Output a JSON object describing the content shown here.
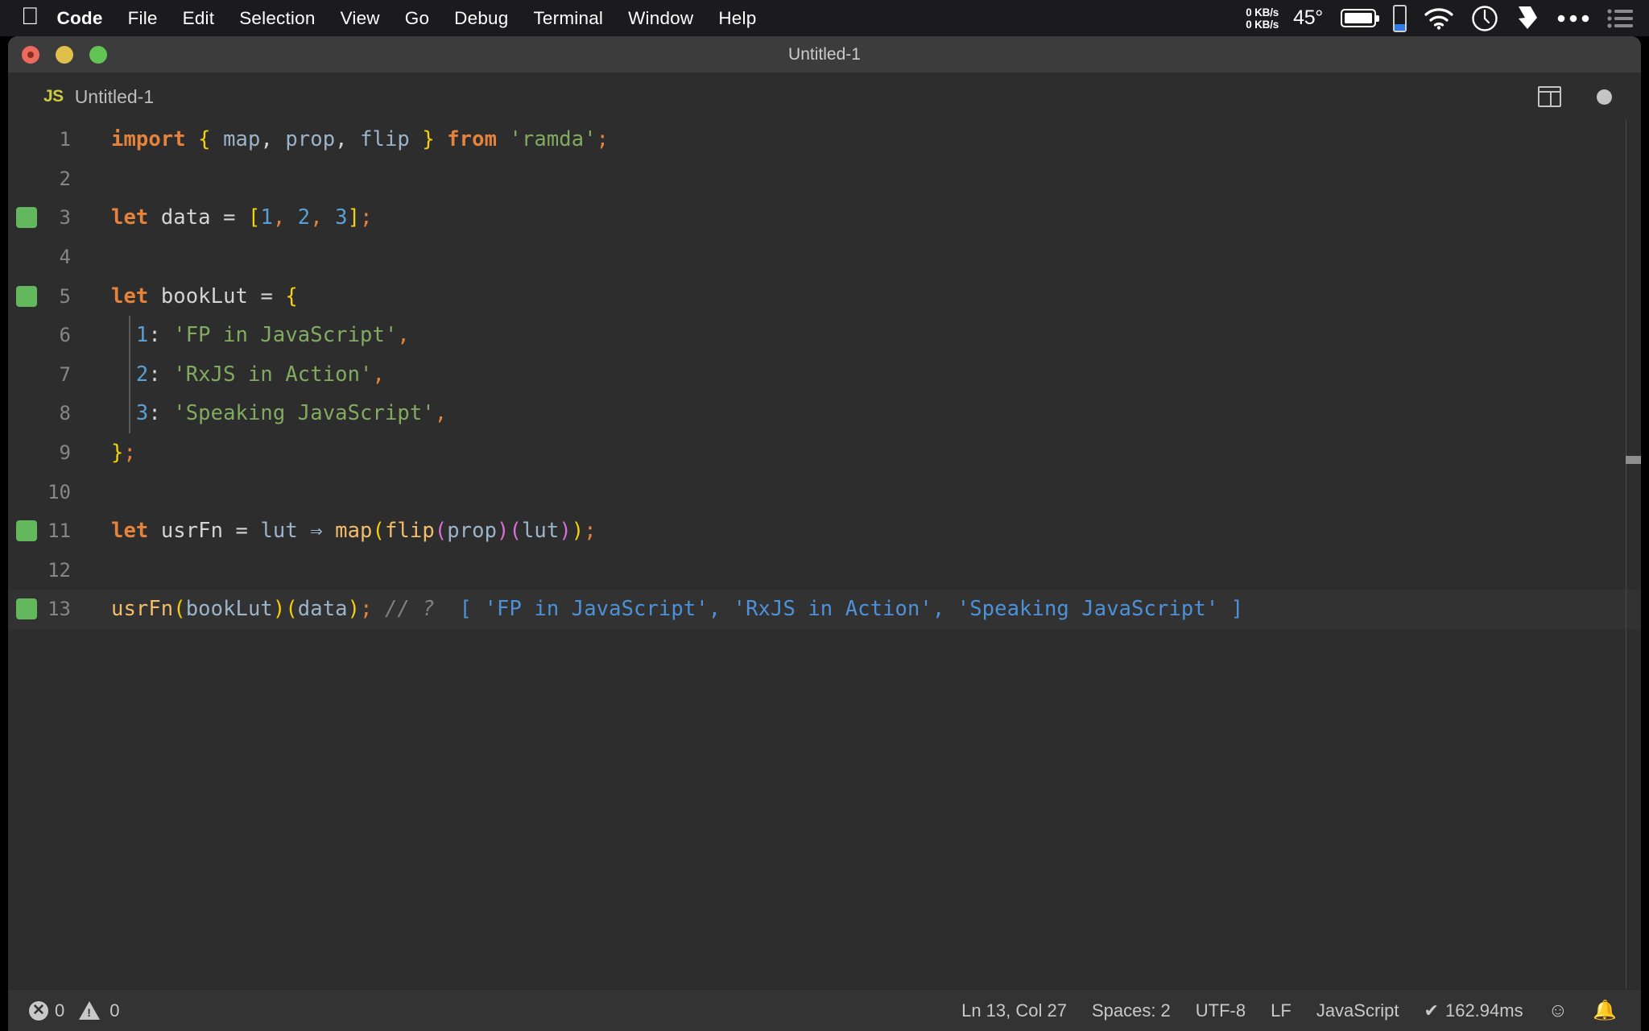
{
  "menubar": {
    "apple_icon": "apple-logo",
    "items": [
      {
        "label": "Code",
        "bold": true
      },
      {
        "label": "File",
        "bold": false
      },
      {
        "label": "Edit",
        "bold": false
      },
      {
        "label": "Selection",
        "bold": false
      },
      {
        "label": "View",
        "bold": false
      },
      {
        "label": "Go",
        "bold": false
      },
      {
        "label": "Debug",
        "bold": false
      },
      {
        "label": "Terminal",
        "bold": false
      },
      {
        "label": "Window",
        "bold": false
      },
      {
        "label": "Help",
        "bold": false
      }
    ],
    "status": {
      "network_up": "0 KB/s",
      "network_down": "0 KB/s",
      "temperature": "45°",
      "battery_icon": "battery-icon",
      "phone_battery_icon": "phone-battery-icon",
      "wifi_icon": "wifi-icon",
      "clock_icon": "clock-icon",
      "dropbox_icon": "dropbox-icon",
      "more_icon": "ellipsis-icon",
      "control_center_icon": "list-icon"
    }
  },
  "window": {
    "title": "Untitled-1",
    "traffic_lights": [
      "close",
      "minimize",
      "zoom"
    ]
  },
  "tab": {
    "file_icon": "JS",
    "label": "Untitled-1",
    "split_editor_icon": "split-editor-icon",
    "unsaved_indicator": "dirty-dot"
  },
  "editor": {
    "lines": [
      {
        "no": "1",
        "breakpoint": false,
        "indent_guide": false,
        "current": false,
        "tokens": [
          {
            "t": "import",
            "c": "kw"
          },
          {
            "t": " ",
            "c": "punct"
          },
          {
            "t": "{",
            "c": "br1"
          },
          {
            "t": " ",
            "c": "punct"
          },
          {
            "t": "map",
            "c": "ident"
          },
          {
            "t": ",",
            "c": "punct"
          },
          {
            "t": " ",
            "c": "punct"
          },
          {
            "t": "prop",
            "c": "ident"
          },
          {
            "t": ",",
            "c": "punct"
          },
          {
            "t": " ",
            "c": "punct"
          },
          {
            "t": "flip",
            "c": "ident"
          },
          {
            "t": " ",
            "c": "punct"
          },
          {
            "t": "}",
            "c": "br1"
          },
          {
            "t": " ",
            "c": "punct"
          },
          {
            "t": "from",
            "c": "kw"
          },
          {
            "t": " ",
            "c": "punct"
          },
          {
            "t": "'ramda'",
            "c": "str"
          },
          {
            "t": ";",
            "c": "semi"
          }
        ]
      },
      {
        "no": "2",
        "breakpoint": false,
        "indent_guide": false,
        "current": false,
        "tokens": []
      },
      {
        "no": "3",
        "breakpoint": true,
        "indent_guide": false,
        "current": false,
        "tokens": [
          {
            "t": "let",
            "c": "kw"
          },
          {
            "t": " ",
            "c": "punct"
          },
          {
            "t": "data",
            "c": "var"
          },
          {
            "t": " ",
            "c": "punct"
          },
          {
            "t": "=",
            "c": "op"
          },
          {
            "t": " ",
            "c": "punct"
          },
          {
            "t": "[",
            "c": "br1"
          },
          {
            "t": "1",
            "c": "num"
          },
          {
            "t": ",",
            "c": "semi"
          },
          {
            "t": " ",
            "c": "punct"
          },
          {
            "t": "2",
            "c": "num"
          },
          {
            "t": ",",
            "c": "semi"
          },
          {
            "t": " ",
            "c": "punct"
          },
          {
            "t": "3",
            "c": "num"
          },
          {
            "t": "]",
            "c": "br1"
          },
          {
            "t": ";",
            "c": "semi"
          }
        ]
      },
      {
        "no": "4",
        "breakpoint": false,
        "indent_guide": false,
        "current": false,
        "tokens": []
      },
      {
        "no": "5",
        "breakpoint": true,
        "indent_guide": false,
        "current": false,
        "tokens": [
          {
            "t": "let",
            "c": "kw"
          },
          {
            "t": " ",
            "c": "punct"
          },
          {
            "t": "bookLut",
            "c": "var"
          },
          {
            "t": " ",
            "c": "punct"
          },
          {
            "t": "=",
            "c": "op"
          },
          {
            "t": " ",
            "c": "punct"
          },
          {
            "t": "{",
            "c": "br1"
          }
        ]
      },
      {
        "no": "6",
        "breakpoint": false,
        "indent_guide": true,
        "current": false,
        "tokens": [
          {
            "t": "  ",
            "c": "punct"
          },
          {
            "t": "1",
            "c": "num"
          },
          {
            "t": ":",
            "c": "punct"
          },
          {
            "t": " ",
            "c": "punct"
          },
          {
            "t": "'FP in JavaScript'",
            "c": "str"
          },
          {
            "t": ",",
            "c": "semi"
          }
        ]
      },
      {
        "no": "7",
        "breakpoint": false,
        "indent_guide": true,
        "current": false,
        "tokens": [
          {
            "t": "  ",
            "c": "punct"
          },
          {
            "t": "2",
            "c": "num"
          },
          {
            "t": ":",
            "c": "punct"
          },
          {
            "t": " ",
            "c": "punct"
          },
          {
            "t": "'RxJS in Action'",
            "c": "str"
          },
          {
            "t": ",",
            "c": "semi"
          }
        ]
      },
      {
        "no": "8",
        "breakpoint": false,
        "indent_guide": true,
        "current": false,
        "tokens": [
          {
            "t": "  ",
            "c": "punct"
          },
          {
            "t": "3",
            "c": "num"
          },
          {
            "t": ":",
            "c": "punct"
          },
          {
            "t": " ",
            "c": "punct"
          },
          {
            "t": "'Speaking JavaScript'",
            "c": "str"
          },
          {
            "t": ",",
            "c": "semi"
          }
        ]
      },
      {
        "no": "9",
        "breakpoint": false,
        "indent_guide": false,
        "current": false,
        "tokens": [
          {
            "t": "}",
            "c": "br1"
          },
          {
            "t": ";",
            "c": "semi"
          }
        ]
      },
      {
        "no": "10",
        "breakpoint": false,
        "indent_guide": false,
        "current": false,
        "tokens": []
      },
      {
        "no": "11",
        "breakpoint": true,
        "indent_guide": false,
        "current": false,
        "tokens": [
          {
            "t": "let",
            "c": "kw"
          },
          {
            "t": " ",
            "c": "punct"
          },
          {
            "t": "usrFn",
            "c": "var"
          },
          {
            "t": " ",
            "c": "punct"
          },
          {
            "t": "=",
            "c": "op"
          },
          {
            "t": " ",
            "c": "punct"
          },
          {
            "t": "lut",
            "c": "ident"
          },
          {
            "t": " ",
            "c": "punct"
          },
          {
            "t": "⇒",
            "c": "arrow"
          },
          {
            "t": " ",
            "c": "punct"
          },
          {
            "t": "map",
            "c": "fn"
          },
          {
            "t": "(",
            "c": "br1"
          },
          {
            "t": "flip",
            "c": "fn"
          },
          {
            "t": "(",
            "c": "br2"
          },
          {
            "t": "prop",
            "c": "ident"
          },
          {
            "t": ")",
            "c": "br2"
          },
          {
            "t": "(",
            "c": "br2"
          },
          {
            "t": "lut",
            "c": "ident"
          },
          {
            "t": ")",
            "c": "br2"
          },
          {
            "t": ")",
            "c": "br1"
          },
          {
            "t": ";",
            "c": "semi"
          }
        ]
      },
      {
        "no": "12",
        "breakpoint": false,
        "indent_guide": false,
        "current": false,
        "tokens": []
      },
      {
        "no": "13",
        "breakpoint": true,
        "indent_guide": false,
        "current": true,
        "tokens": [
          {
            "t": "usrFn",
            "c": "fn"
          },
          {
            "t": "(",
            "c": "br1"
          },
          {
            "t": "bookLut",
            "c": "ident"
          },
          {
            "t": ")",
            "c": "br1"
          },
          {
            "t": "(",
            "c": "br1"
          },
          {
            "t": "data",
            "c": "ident"
          },
          {
            "t": ")",
            "c": "br1"
          },
          {
            "t": ";",
            "c": "semi"
          },
          {
            "t": " ",
            "c": "punct"
          },
          {
            "t": "// ?",
            "c": "comment"
          },
          {
            "t": "  [ 'FP in JavaScript', 'RxJS in Action', 'Speaking JavaScript' ]",
            "c": "inline-res"
          }
        ]
      }
    ]
  },
  "statusbar": {
    "errors_icon": "error-icon",
    "errors_count": "0",
    "warnings_icon": "warning-icon",
    "warnings_count": "0",
    "cursor_position": "Ln 13, Col 27",
    "indentation": "Spaces: 2",
    "encoding": "UTF-8",
    "eol": "LF",
    "language": "JavaScript",
    "quokka_check": "✔",
    "quokka_time": "162.94ms",
    "feedback_icon": "smiley-icon",
    "notifications_icon": "bell-icon"
  }
}
